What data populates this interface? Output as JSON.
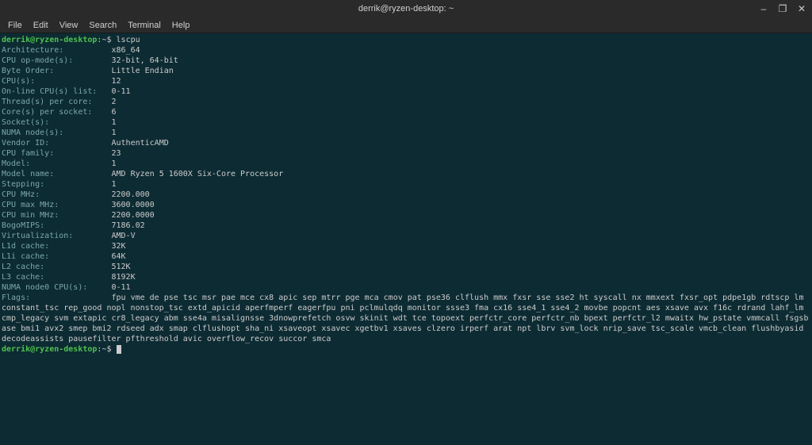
{
  "window": {
    "title": "derrik@ryzen-desktop: ~",
    "controls": {
      "min": "–",
      "max": "❐",
      "close": "✕"
    }
  },
  "menu": {
    "file": "File",
    "edit": "Edit",
    "view": "View",
    "search": "Search",
    "terminal": "Terminal",
    "help": "Help"
  },
  "prompt": {
    "user_host": "derrik@ryzen-desktop",
    "colon": ":",
    "dir": "~",
    "dollar": "$"
  },
  "command": "lscpu",
  "lscpu": [
    {
      "k": "Architecture:",
      "v": "x86_64"
    },
    {
      "k": "CPU op-mode(s):",
      "v": "32-bit, 64-bit"
    },
    {
      "k": "Byte Order:",
      "v": "Little Endian"
    },
    {
      "k": "CPU(s):",
      "v": "12"
    },
    {
      "k": "On-line CPU(s) list:",
      "v": "0-11"
    },
    {
      "k": "Thread(s) per core:",
      "v": "2"
    },
    {
      "k": "Core(s) per socket:",
      "v": "6"
    },
    {
      "k": "Socket(s):",
      "v": "1"
    },
    {
      "k": "NUMA node(s):",
      "v": "1"
    },
    {
      "k": "Vendor ID:",
      "v": "AuthenticAMD"
    },
    {
      "k": "CPU family:",
      "v": "23"
    },
    {
      "k": "Model:",
      "v": "1"
    },
    {
      "k": "Model name:",
      "v": "AMD Ryzen 5 1600X Six-Core Processor"
    },
    {
      "k": "Stepping:",
      "v": "1"
    },
    {
      "k": "CPU MHz:",
      "v": "2200.000"
    },
    {
      "k": "CPU max MHz:",
      "v": "3600.0000"
    },
    {
      "k": "CPU min MHz:",
      "v": "2200.0000"
    },
    {
      "k": "BogoMIPS:",
      "v": "7186.02"
    },
    {
      "k": "Virtualization:",
      "v": "AMD-V"
    },
    {
      "k": "L1d cache:",
      "v": "32K"
    },
    {
      "k": "L1i cache:",
      "v": "64K"
    },
    {
      "k": "L2 cache:",
      "v": "512K"
    },
    {
      "k": "L3 cache:",
      "v": "8192K"
    },
    {
      "k": "NUMA node0 CPU(s):",
      "v": "0-11"
    }
  ],
  "flags_label": "Flags:",
  "flags_value": "fpu vme de pse tsc msr pae mce cx8 apic sep mtrr pge mca cmov pat pse36 clflush mmx fxsr sse sse2 ht syscall nx mmxext fxsr_opt pdpe1gb rdtscp lm constant_tsc rep_good nopl nonstop_tsc extd_apicid aperfmperf eagerfpu pni pclmulqdq monitor ssse3 fma cx16 sse4_1 sse4_2 movbe popcnt aes xsave avx f16c rdrand lahf_lm cmp_legacy svm extapic cr8_legacy abm sse4a misalignsse 3dnowprefetch osvw skinit wdt tce topoext perfctr_core perfctr_nb bpext perfctr_l2 mwaitx hw_pstate vmmcall fsgsbase bmi1 avx2 smep bmi2 rdseed adx smap clflushopt sha_ni xsaveopt xsavec xgetbv1 xsaves clzero irperf arat npt lbrv svm_lock nrip_save tsc_scale vmcb_clean flushbyasid decodeassists pausefilter pfthreshold avic overflow_recov succor smca"
}
